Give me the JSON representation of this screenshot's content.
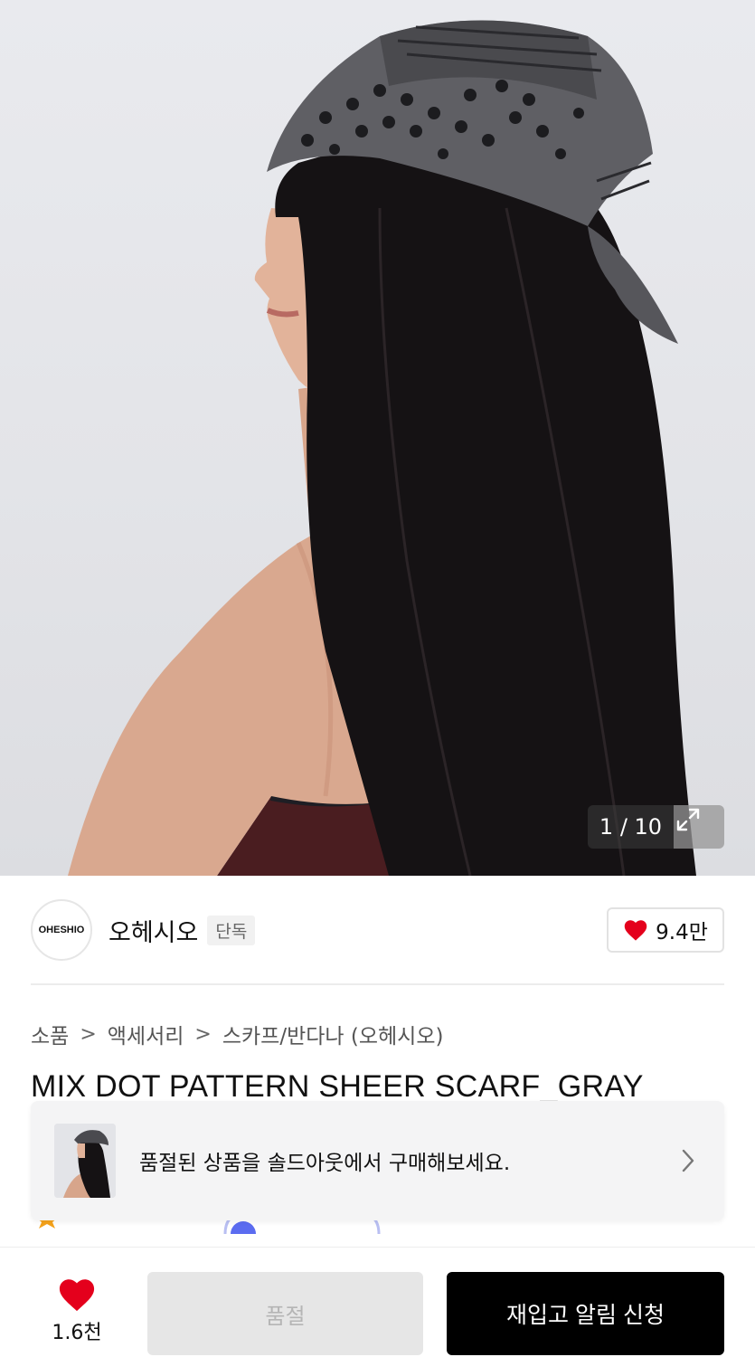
{
  "gallery": {
    "counter": "1 / 10",
    "expand_icon": "expand-icon"
  },
  "brand": {
    "logo_text": "OHESHIO",
    "name": "오헤시오",
    "tag": "단독",
    "likes": "9.4만",
    "heart_color": "#e4001c"
  },
  "breadcrumb": {
    "items": [
      "소품",
      "액세서리",
      "스카프/반다나 (오헤시오)"
    ]
  },
  "product": {
    "title": "MIX DOT PATTERN SHEER SCARF_GRAY"
  },
  "banner": {
    "text": "품절된 상품을 솔드아웃에서 구매해보세요."
  },
  "bottom_bar": {
    "wish_count": "1.6천",
    "soldout_label": "품절",
    "restock_label": "재입고 알림 신청",
    "heart_color": "#e4001c"
  }
}
